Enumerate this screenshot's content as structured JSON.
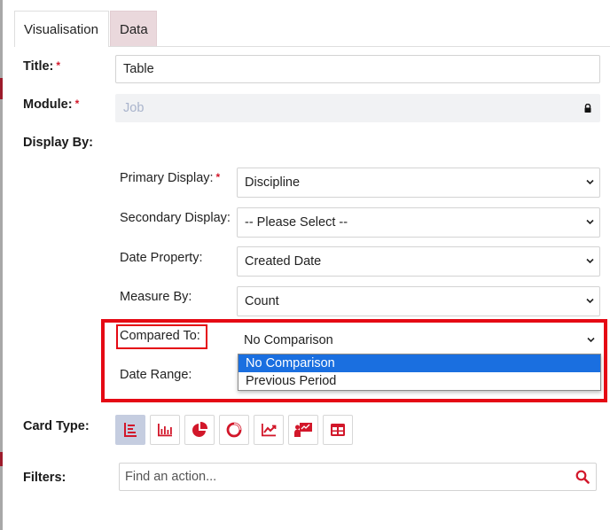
{
  "tabs": {
    "visualisation": "Visualisation",
    "data": "Data"
  },
  "form": {
    "title_label": "Title:",
    "title_value": "Table",
    "module_label": "Module:",
    "module_value": "Job",
    "required_mark": "*",
    "display_by_label": "Display By:",
    "primary_label": "Primary Display:",
    "primary_value": "Discipline",
    "secondary_label": "Secondary Display:",
    "secondary_value": "-- Please Select --",
    "date_property_label": "Date Property:",
    "date_property_value": "Created Date",
    "measure_label": "Measure By:",
    "measure_value": "Count",
    "compared_label": "Compared To:",
    "compared_value": "No Comparison",
    "compared_options": [
      "No Comparison",
      "Previous Period"
    ],
    "date_range_label": "Date Range:",
    "card_type_label": "Card Type:",
    "filters_label": "Filters:",
    "filters_placeholder": "Find an action..."
  },
  "card_types": [
    "table-list-icon",
    "bar-chart-icon",
    "pie-chart-icon",
    "donut-chart-icon",
    "line-chart-icon",
    "presentation-icon",
    "grid-table-icon"
  ],
  "colors": {
    "accent": "#d2172a",
    "highlight": "#e50914",
    "selected_option": "#1a6fe0",
    "data_tab": "#ead8dc"
  }
}
